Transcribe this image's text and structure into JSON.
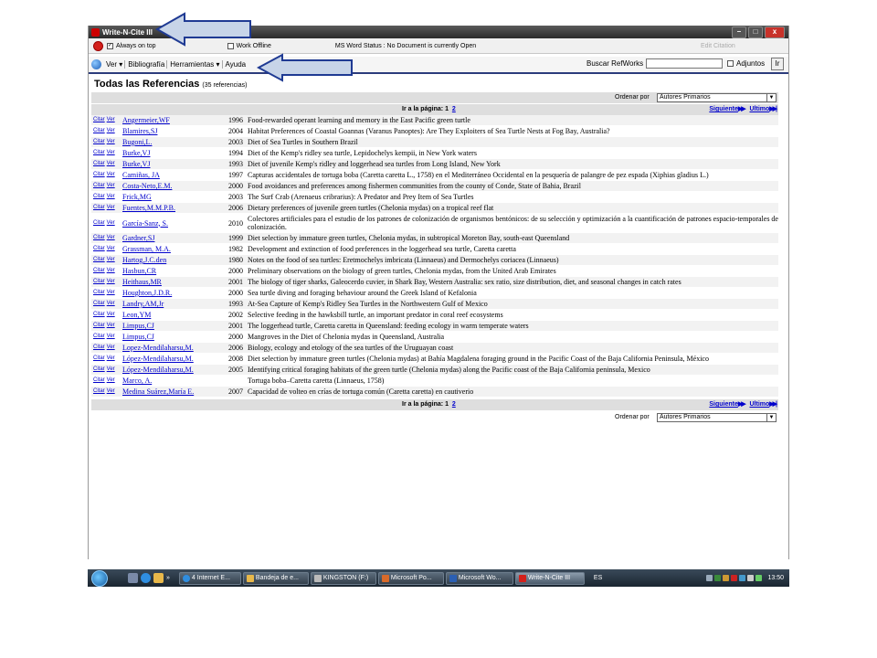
{
  "window": {
    "title": "Write-N-Cite III",
    "always_on_top": "Always on top",
    "always_on_top_checked": "✓",
    "work_offline": "Work Offline",
    "word_status": "MS Word Status : No Document is currently Open",
    "edit_citation": "Edit Citation",
    "min": "–",
    "max": "□",
    "close": "x"
  },
  "menu": {
    "ver": "Ver ▾",
    "bibliografia": "Bibliografía",
    "herramientas": "Herramientas ▾",
    "ayuda": "Ayuda",
    "search_label": "Buscar RefWorks",
    "adjuntos": "Adjuntos",
    "ir": "Ir"
  },
  "heading": {
    "title": "Todas las Referencias",
    "count": "(35 referencias)"
  },
  "sort": {
    "label": "Ordenar  por",
    "selected": "Autores Primarios"
  },
  "pagination": {
    "label": "Ir a la página: 1",
    "page2": "2",
    "next": "Siguiente",
    "last": "Ultimo"
  },
  "row_actions": {
    "cite": "Citar",
    "view": "Ver"
  },
  "references": [
    {
      "author": "Angermeier,WF",
      "year": "1996",
      "title": "Food-rewarded operant learning and memory in the East Pacific green turtle"
    },
    {
      "author": "Blamires,SJ",
      "year": "2004",
      "title": "Habitat Preferences of Coastal Goannas (Varanus Panoptes): Are They Exploiters of Sea Turtle Nests at Fog Bay, Australia?"
    },
    {
      "author": "Bugoni,L.",
      "year": "2003",
      "title": "Diet of Sea Turtles in Southern Brazil"
    },
    {
      "author": "Burke,VJ",
      "year": "1994",
      "title": "Diet of the Kemp's ridley sea turtle, Lepidochelys kempii, in New York waters"
    },
    {
      "author": "Burke,VJ",
      "year": "1993",
      "title": "Diet of juvenile Kemp's ridley and loggerhead sea turtles from Long Island, New York"
    },
    {
      "author": "Camiñas, JA",
      "year": "1997",
      "title": "Capturas accidentales de tortuga boba (Caretta caretta L., 1758) en el Mediterráneo Occidental en la pesquería de palangre de pez espada (Xiphias gladius L.)"
    },
    {
      "author": "Costa-Neto,E.M.",
      "year": "2000",
      "title": "Food avoidances and preferences among fishermen communities from the county of Conde, State of Bahia, Brazil"
    },
    {
      "author": "Frick,MG",
      "year": "2003",
      "title": "The Surf Crab (Arenaeus cribrarius): A Predator and Prey Item of Sea Turtles"
    },
    {
      "author": "Fuentes,M.M.P.B.",
      "year": "2006",
      "title": "Dietary preferences of juvenile green turtles (Chelonia mydas) on a tropical reef flat"
    },
    {
      "author": "García-Sanz, S.",
      "year": "2010",
      "title": "Colectores artificiales para el estudio de los patrones de colonización de organismos bentónicos: de su selección y optimización a la cuantificación de patrones espacio-temporales de colonización."
    },
    {
      "author": "Gardner,SJ",
      "year": "1999",
      "title": "Diet selection by immature green turtles, Chelonia mydas, in subtropical Moreton Bay, south-east Queensland"
    },
    {
      "author": "Grassman, M.A.",
      "year": "1982",
      "title": "Development and extinction of food preferences in the loggerhead sea turtle, Caretta caretta"
    },
    {
      "author": "Hartog,J.C.den",
      "year": "1980",
      "title": "Notes on the food of sea turtles: Eretmochelys imbricata (Linnaeus) and Dermochelys coriacea (Linnaeus)"
    },
    {
      "author": "Hasbun,CR",
      "year": "2000",
      "title": "Preliminary observations on the biology of green turtles, Chelonia mydas, from the United Arab Emirates"
    },
    {
      "author": "Heithaus,MR",
      "year": "2001",
      "title": "The biology of tiger sharks, Galeocerdo cuvier, in Shark Bay, Western Australia: sex ratio, size distribution, diet, and seasonal changes in catch rates"
    },
    {
      "author": "Houghton,J.D.R.",
      "year": "2000",
      "title": "Sea turtle diving and foraging behaviour around the Greek Island of Kefalonia"
    },
    {
      "author": "Landry,AM,Jr",
      "year": "1993",
      "title": "At-Sea Capture of Kemp's Ridley Sea Turtles in the Northwestern Gulf of Mexico"
    },
    {
      "author": "Leon,YM",
      "year": "2002",
      "title": "Selective feeding in the hawksbill turtle, an important predator in coral reef ecosystems"
    },
    {
      "author": "Limpus,CJ",
      "year": "2001",
      "title": "The loggerhead turtle, Caretta caretta in Queensland: feeding ecology in warm temperate waters"
    },
    {
      "author": "Limpus,CJ",
      "year": "2000",
      "title": "Mangroves in the Diet of Chelonia mydas in Queensland, Australia"
    },
    {
      "author": "Lopez-Mendilaharsu,M.",
      "year": "2006",
      "title": "Biology, ecology and etology of the sea turtles of the Uruguayan coast"
    },
    {
      "author": "López-Mendilaharsu,M.",
      "year": "2008",
      "title": "Diet selection by immature green turtles (Chelonia mydas) at Bahía Magdalena foraging ground in the Pacific Coast of the Baja California Peninsula, México"
    },
    {
      "author": "López-Mendilaharsu,M.",
      "year": "2005",
      "title": "Identifying critical foraging habitats of the green turtle (Chelonia mydas) along the Pacific coast of the Baja California peninsula, Mexico"
    },
    {
      "author": "Marco, A.",
      "year": "",
      "title": "Tortuga boba–Caretta caretta (Linnaeus, 1758)"
    },
    {
      "author": "Medina Suárez,María E.",
      "year": "2007",
      "title": "Capacidad de volteo en crías de tortuga común (Caretta caretta) en cautiverio"
    }
  ],
  "taskbar": {
    "chevron": "»",
    "items": [
      "4 Internet E...",
      "Bandeja de e...",
      "KINGSTON (F:)",
      "Microsoft Po...",
      "Microsoft Wo...",
      "Write-N-Cite III"
    ],
    "lang": "ES",
    "clock": "13:50"
  },
  "colors": {
    "accent_navy": "#2c3c7c",
    "link_blue": "#0000cc",
    "arrow_fill": "#c7d4e8",
    "arrow_stroke": "#1f3a93",
    "red_icon": "#d3201b"
  }
}
